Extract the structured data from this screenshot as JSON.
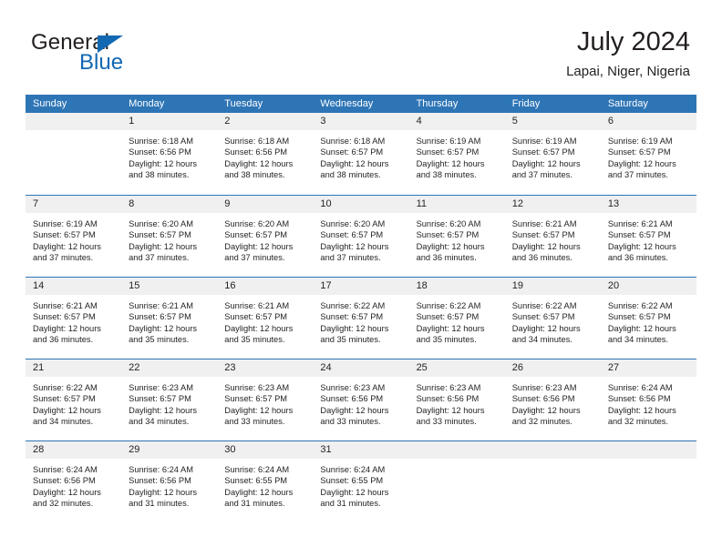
{
  "brand": {
    "name_part1": "General",
    "name_part2": "Blue",
    "triangle_icon": "triangle-icon",
    "accent_color": "#1268b3"
  },
  "header": {
    "title": "July 2024",
    "subtitle": "Lapai, Niger, Nigeria"
  },
  "calendar": {
    "header_color": "#2e75b6",
    "day_band_color": "#f0f0f0",
    "weekdays": [
      "Sunday",
      "Monday",
      "Tuesday",
      "Wednesday",
      "Thursday",
      "Friday",
      "Saturday"
    ],
    "weeks": [
      [
        {
          "day": "",
          "empty": true,
          "sunrise": "",
          "sunset": "",
          "daylight_line1": "",
          "daylight_line2": ""
        },
        {
          "day": "1",
          "empty": false,
          "sunrise": "Sunrise: 6:18 AM",
          "sunset": "Sunset: 6:56 PM",
          "daylight_line1": "Daylight: 12 hours",
          "daylight_line2": "and 38 minutes."
        },
        {
          "day": "2",
          "empty": false,
          "sunrise": "Sunrise: 6:18 AM",
          "sunset": "Sunset: 6:56 PM",
          "daylight_line1": "Daylight: 12 hours",
          "daylight_line2": "and 38 minutes."
        },
        {
          "day": "3",
          "empty": false,
          "sunrise": "Sunrise: 6:18 AM",
          "sunset": "Sunset: 6:57 PM",
          "daylight_line1": "Daylight: 12 hours",
          "daylight_line2": "and 38 minutes."
        },
        {
          "day": "4",
          "empty": false,
          "sunrise": "Sunrise: 6:19 AM",
          "sunset": "Sunset: 6:57 PM",
          "daylight_line1": "Daylight: 12 hours",
          "daylight_line2": "and 38 minutes."
        },
        {
          "day": "5",
          "empty": false,
          "sunrise": "Sunrise: 6:19 AM",
          "sunset": "Sunset: 6:57 PM",
          "daylight_line1": "Daylight: 12 hours",
          "daylight_line2": "and 37 minutes."
        },
        {
          "day": "6",
          "empty": false,
          "sunrise": "Sunrise: 6:19 AM",
          "sunset": "Sunset: 6:57 PM",
          "daylight_line1": "Daylight: 12 hours",
          "daylight_line2": "and 37 minutes."
        }
      ],
      [
        {
          "day": "7",
          "empty": false,
          "sunrise": "Sunrise: 6:19 AM",
          "sunset": "Sunset: 6:57 PM",
          "daylight_line1": "Daylight: 12 hours",
          "daylight_line2": "and 37 minutes."
        },
        {
          "day": "8",
          "empty": false,
          "sunrise": "Sunrise: 6:20 AM",
          "sunset": "Sunset: 6:57 PM",
          "daylight_line1": "Daylight: 12 hours",
          "daylight_line2": "and 37 minutes."
        },
        {
          "day": "9",
          "empty": false,
          "sunrise": "Sunrise: 6:20 AM",
          "sunset": "Sunset: 6:57 PM",
          "daylight_line1": "Daylight: 12 hours",
          "daylight_line2": "and 37 minutes."
        },
        {
          "day": "10",
          "empty": false,
          "sunrise": "Sunrise: 6:20 AM",
          "sunset": "Sunset: 6:57 PM",
          "daylight_line1": "Daylight: 12 hours",
          "daylight_line2": "and 37 minutes."
        },
        {
          "day": "11",
          "empty": false,
          "sunrise": "Sunrise: 6:20 AM",
          "sunset": "Sunset: 6:57 PM",
          "daylight_line1": "Daylight: 12 hours",
          "daylight_line2": "and 36 minutes."
        },
        {
          "day": "12",
          "empty": false,
          "sunrise": "Sunrise: 6:21 AM",
          "sunset": "Sunset: 6:57 PM",
          "daylight_line1": "Daylight: 12 hours",
          "daylight_line2": "and 36 minutes."
        },
        {
          "day": "13",
          "empty": false,
          "sunrise": "Sunrise: 6:21 AM",
          "sunset": "Sunset: 6:57 PM",
          "daylight_line1": "Daylight: 12 hours",
          "daylight_line2": "and 36 minutes."
        }
      ],
      [
        {
          "day": "14",
          "empty": false,
          "sunrise": "Sunrise: 6:21 AM",
          "sunset": "Sunset: 6:57 PM",
          "daylight_line1": "Daylight: 12 hours",
          "daylight_line2": "and 36 minutes."
        },
        {
          "day": "15",
          "empty": false,
          "sunrise": "Sunrise: 6:21 AM",
          "sunset": "Sunset: 6:57 PM",
          "daylight_line1": "Daylight: 12 hours",
          "daylight_line2": "and 35 minutes."
        },
        {
          "day": "16",
          "empty": false,
          "sunrise": "Sunrise: 6:21 AM",
          "sunset": "Sunset: 6:57 PM",
          "daylight_line1": "Daylight: 12 hours",
          "daylight_line2": "and 35 minutes."
        },
        {
          "day": "17",
          "empty": false,
          "sunrise": "Sunrise: 6:22 AM",
          "sunset": "Sunset: 6:57 PM",
          "daylight_line1": "Daylight: 12 hours",
          "daylight_line2": "and 35 minutes."
        },
        {
          "day": "18",
          "empty": false,
          "sunrise": "Sunrise: 6:22 AM",
          "sunset": "Sunset: 6:57 PM",
          "daylight_line1": "Daylight: 12 hours",
          "daylight_line2": "and 35 minutes."
        },
        {
          "day": "19",
          "empty": false,
          "sunrise": "Sunrise: 6:22 AM",
          "sunset": "Sunset: 6:57 PM",
          "daylight_line1": "Daylight: 12 hours",
          "daylight_line2": "and 34 minutes."
        },
        {
          "day": "20",
          "empty": false,
          "sunrise": "Sunrise: 6:22 AM",
          "sunset": "Sunset: 6:57 PM",
          "daylight_line1": "Daylight: 12 hours",
          "daylight_line2": "and 34 minutes."
        }
      ],
      [
        {
          "day": "21",
          "empty": false,
          "sunrise": "Sunrise: 6:22 AM",
          "sunset": "Sunset: 6:57 PM",
          "daylight_line1": "Daylight: 12 hours",
          "daylight_line2": "and 34 minutes."
        },
        {
          "day": "22",
          "empty": false,
          "sunrise": "Sunrise: 6:23 AM",
          "sunset": "Sunset: 6:57 PM",
          "daylight_line1": "Daylight: 12 hours",
          "daylight_line2": "and 34 minutes."
        },
        {
          "day": "23",
          "empty": false,
          "sunrise": "Sunrise: 6:23 AM",
          "sunset": "Sunset: 6:57 PM",
          "daylight_line1": "Daylight: 12 hours",
          "daylight_line2": "and 33 minutes."
        },
        {
          "day": "24",
          "empty": false,
          "sunrise": "Sunrise: 6:23 AM",
          "sunset": "Sunset: 6:56 PM",
          "daylight_line1": "Daylight: 12 hours",
          "daylight_line2": "and 33 minutes."
        },
        {
          "day": "25",
          "empty": false,
          "sunrise": "Sunrise: 6:23 AM",
          "sunset": "Sunset: 6:56 PM",
          "daylight_line1": "Daylight: 12 hours",
          "daylight_line2": "and 33 minutes."
        },
        {
          "day": "26",
          "empty": false,
          "sunrise": "Sunrise: 6:23 AM",
          "sunset": "Sunset: 6:56 PM",
          "daylight_line1": "Daylight: 12 hours",
          "daylight_line2": "and 32 minutes."
        },
        {
          "day": "27",
          "empty": false,
          "sunrise": "Sunrise: 6:24 AM",
          "sunset": "Sunset: 6:56 PM",
          "daylight_line1": "Daylight: 12 hours",
          "daylight_line2": "and 32 minutes."
        }
      ],
      [
        {
          "day": "28",
          "empty": false,
          "sunrise": "Sunrise: 6:24 AM",
          "sunset": "Sunset: 6:56 PM",
          "daylight_line1": "Daylight: 12 hours",
          "daylight_line2": "and 32 minutes."
        },
        {
          "day": "29",
          "empty": false,
          "sunrise": "Sunrise: 6:24 AM",
          "sunset": "Sunset: 6:56 PM",
          "daylight_line1": "Daylight: 12 hours",
          "daylight_line2": "and 31 minutes."
        },
        {
          "day": "30",
          "empty": false,
          "sunrise": "Sunrise: 6:24 AM",
          "sunset": "Sunset: 6:55 PM",
          "daylight_line1": "Daylight: 12 hours",
          "daylight_line2": "and 31 minutes."
        },
        {
          "day": "31",
          "empty": false,
          "sunrise": "Sunrise: 6:24 AM",
          "sunset": "Sunset: 6:55 PM",
          "daylight_line1": "Daylight: 12 hours",
          "daylight_line2": "and 31 minutes."
        },
        {
          "day": "",
          "empty": true,
          "sunrise": "",
          "sunset": "",
          "daylight_line1": "",
          "daylight_line2": ""
        },
        {
          "day": "",
          "empty": true,
          "sunrise": "",
          "sunset": "",
          "daylight_line1": "",
          "daylight_line2": ""
        },
        {
          "day": "",
          "empty": true,
          "sunrise": "",
          "sunset": "",
          "daylight_line1": "",
          "daylight_line2": ""
        }
      ]
    ]
  }
}
